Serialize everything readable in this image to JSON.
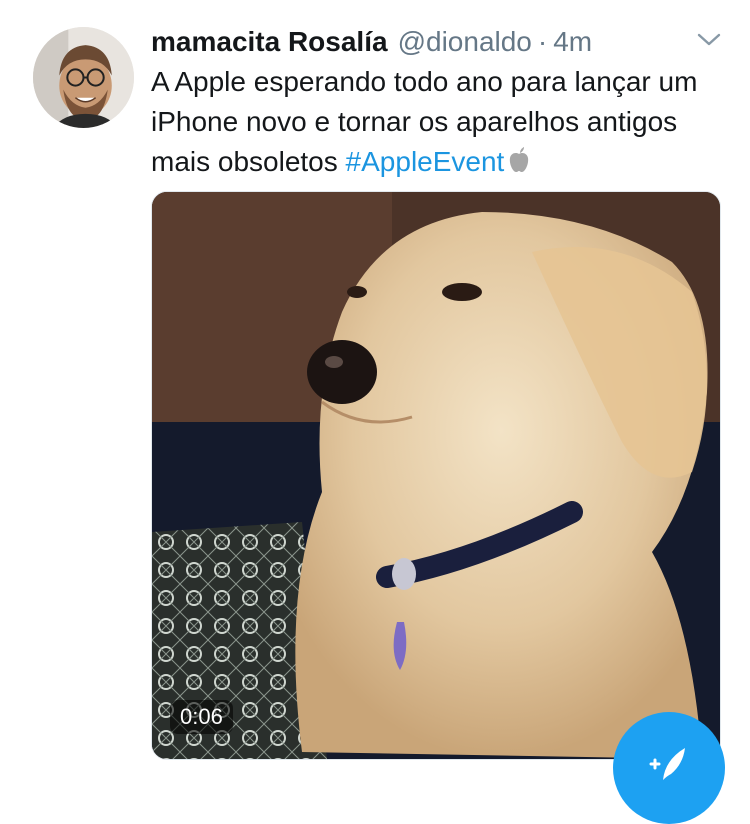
{
  "tweet": {
    "display_name": "mamacita Rosalía",
    "handle": "@dionaldo",
    "separator": "·",
    "time": "4m",
    "text_before_hashtag": "A Apple esperando todo ano para lançar um iPhone novo e tornar os aparelhos antigos mais obsoletos ",
    "hashtag": "#AppleEvent",
    "trailing_icon": "apple-logo-icon"
  },
  "media": {
    "type": "video",
    "duration": "0:06"
  },
  "actions": {
    "menu_icon": "chevron-down-icon",
    "compose_icon": "compose-tweet-icon"
  },
  "colors": {
    "link": "#1b95e0",
    "fab": "#1da1f2",
    "secondary_text": "#657786",
    "primary_text": "#14171a"
  }
}
